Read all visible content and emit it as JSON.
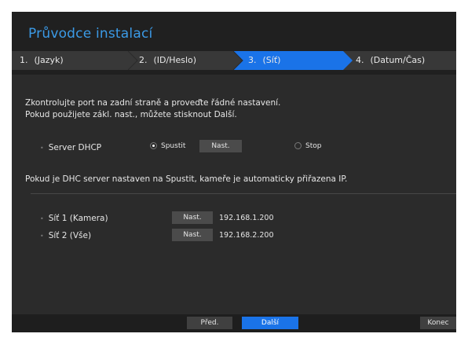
{
  "window": {
    "title": "Průvodce instalací"
  },
  "steps": [
    {
      "num": "1.",
      "label": "(Jazyk)",
      "active": false
    },
    {
      "num": "2.",
      "label": "(ID/Heslo)",
      "active": false
    },
    {
      "num": "3.",
      "label": "(Síť)",
      "active": true
    },
    {
      "num": "4.",
      "label": "(Datum/Čas)",
      "active": false
    }
  ],
  "description": {
    "line1": "Zkontrolujte port na zadní straně a proveďte řádné nastavení.",
    "line2": "Pokud použijete zákl. nast., můžete stisknout Další."
  },
  "dhcp": {
    "label": "Server DHCP",
    "option_start": "Spustit",
    "option_stop": "Stop",
    "selected": "Spustit",
    "setup_button": "Nast.",
    "note": "Pokud je DHC server nastaven na Spustit, kameře je automaticky přiřazena IP."
  },
  "networks": [
    {
      "label": "Síť 1 (Kamera)",
      "button": "Nast.",
      "ip": "192.168.1.200"
    },
    {
      "label": "Síť 2 (Vše)",
      "button": "Nast.",
      "ip": "192.168.2.200"
    }
  ],
  "footer": {
    "prev": "Před.",
    "next": "Další",
    "exit": "Konec"
  },
  "colors": {
    "accent": "#1a73e8",
    "title": "#3b9ae6",
    "background": "#2b2b2b"
  }
}
